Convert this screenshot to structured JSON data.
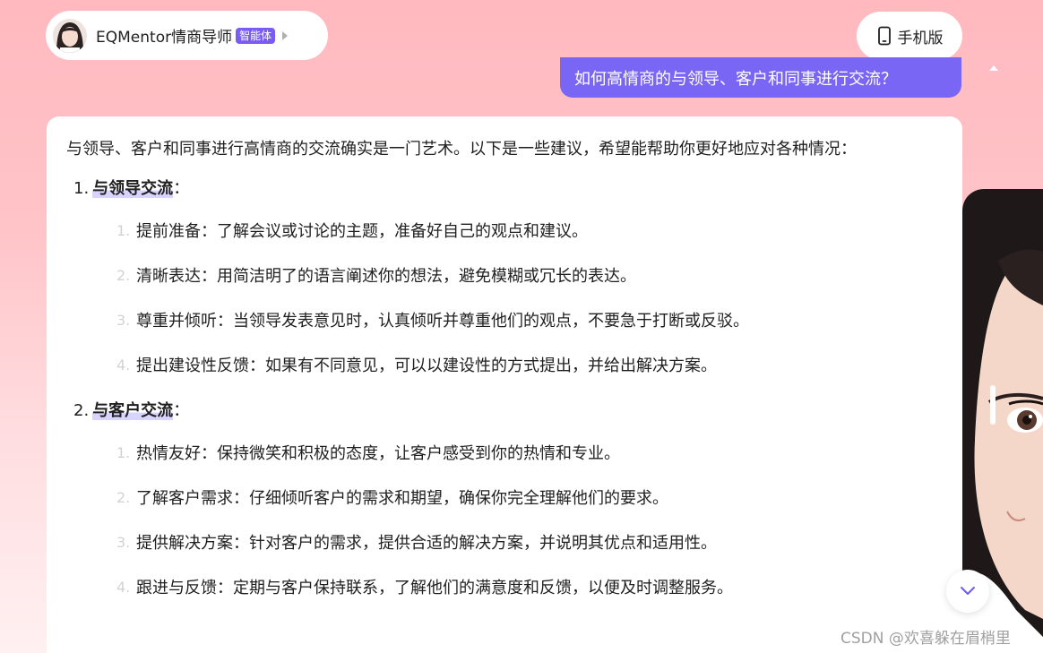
{
  "header": {
    "agent_name": "EQMentor情商导师",
    "agent_badge": "智能体",
    "mobile_label": "手机版"
  },
  "user_message": "如何高情商的与领导、客户和同事进行交流？",
  "answer": {
    "intro": "与领导、客户和同事进行高情商的交流确实是一门艺术。以下是一些建议，希望能帮助你更好地应对各种情况：",
    "sections": [
      {
        "number": "1.",
        "title": "与领导交流",
        "suffix": "：",
        "items": [
          {
            "number": "1.",
            "text": "提前准备：了解会议或讨论的主题，准备好自己的观点和建议。"
          },
          {
            "number": "2.",
            "text": "清晰表达：用简洁明了的语言阐述你的想法，避免模糊或冗长的表达。"
          },
          {
            "number": "3.",
            "text": "尊重并倾听：当领导发表意见时，认真倾听并尊重他们的观点，不要急于打断或反驳。"
          },
          {
            "number": "4.",
            "text": "提出建设性反馈：如果有不同意见，可以以建设性的方式提出，并给出解决方案。"
          }
        ]
      },
      {
        "number": "2.",
        "title": "与客户交流",
        "suffix": "：",
        "items": [
          {
            "number": "1.",
            "text": "热情友好：保持微笑和积极的态度，让客户感受到你的热情和专业。"
          },
          {
            "number": "2.",
            "text": "了解客户需求：仔细倾听客户的需求和期望，确保你完全理解他们的要求。"
          },
          {
            "number": "3.",
            "text": "提供解决方案：针对客户的需求，提供合适的解决方案，并说明其优点和适用性。"
          },
          {
            "number": "4.",
            "text": "跟进与反馈：定期与客户保持联系，了解他们的满意度和反馈，以便及时调整服务。"
          }
        ]
      }
    ]
  },
  "watermark": "CSDN @欢喜躲在眉梢里",
  "icons": {
    "avatar": "avatar-icon",
    "arrow": "chevron-right-icon",
    "mobile": "mobile-phone-icon",
    "scroll_up": "caret-up-icon",
    "scroll_down": "chevron-down-icon"
  },
  "colors": {
    "accent": "#7a66f5",
    "badge": "#7a5cf5",
    "background_top": "#ffb9bf"
  }
}
